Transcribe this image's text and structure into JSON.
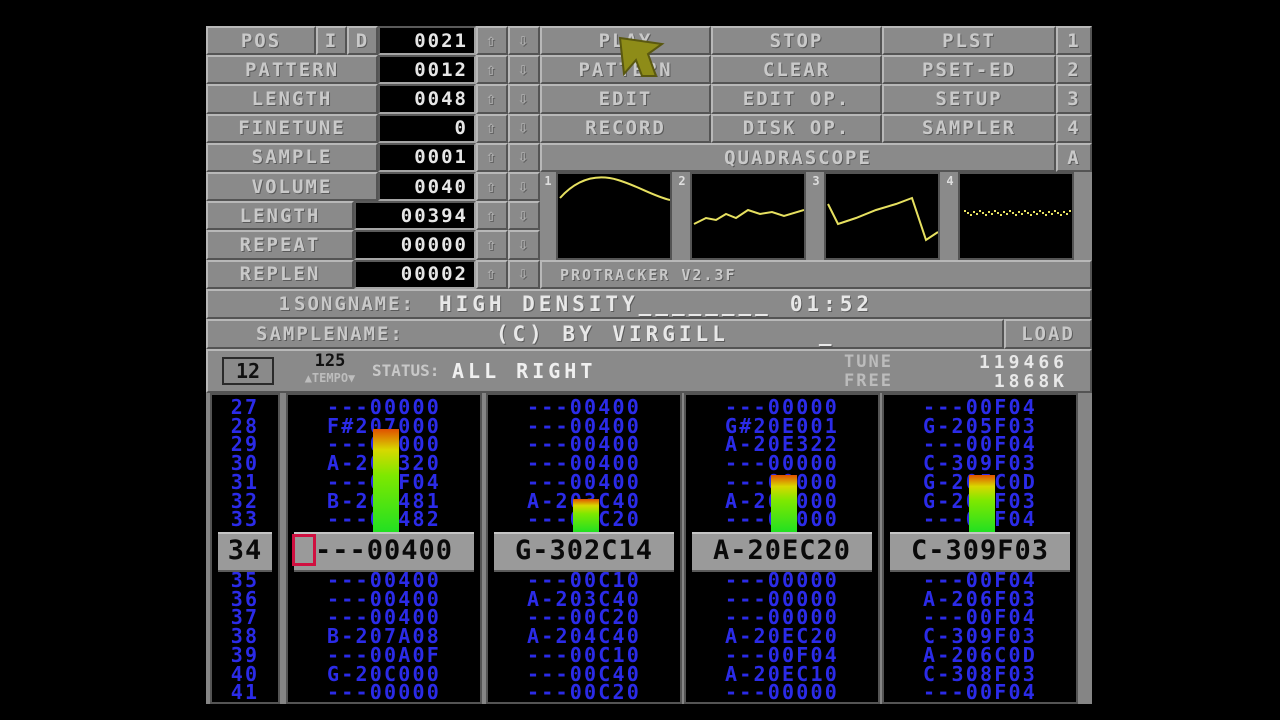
{
  "left_panel": {
    "rows": [
      {
        "label": "POS",
        "value": "0021",
        "extra": [
          "I",
          "D"
        ]
      },
      {
        "label": "PATTERN",
        "value": "0012"
      },
      {
        "label": "LENGTH",
        "value": "0048"
      },
      {
        "label": "FINETUNE",
        "value": "0"
      },
      {
        "label": "SAMPLE",
        "value": "0001"
      },
      {
        "label": "VOLUME",
        "value": "0040"
      },
      {
        "label": "LENGTH",
        "value": "00394"
      },
      {
        "label": "REPEAT",
        "value": "00000"
      },
      {
        "label": "REPLEN",
        "value": "00002"
      }
    ],
    "up_glyph": "⇧",
    "down_glyph": "⇩"
  },
  "menu": {
    "buttons": [
      [
        "PLAY",
        "STOP",
        "PLST",
        "1"
      ],
      [
        "PATTERN",
        "CLEAR",
        "PSET-ED",
        "2"
      ],
      [
        "EDIT",
        "EDIT OP.",
        "SETUP",
        "3"
      ],
      [
        "RECORD",
        "DISK OP.",
        "SAMPLER",
        "4"
      ]
    ],
    "quadrascope": "QUADRASCOPE",
    "quadrascope_key": "A"
  },
  "scopes": {
    "numbers": [
      "1",
      "2",
      "3",
      "4"
    ],
    "wave_color": "#e6e060"
  },
  "version_label": "PROTRACKER V2.3F",
  "song": {
    "prefix": "1",
    "label": "SONGNAME:",
    "name": "HIGH DENSITY________",
    "time": "01:52"
  },
  "sample": {
    "label": "SAMPLENAME:",
    "name": "(C)  BY VIRGILL",
    "underscore": "_",
    "load": "LOAD"
  },
  "status": {
    "octave": "12",
    "tempo_value": "125",
    "tempo_label": "▲TEMPO▼",
    "label": "STATUS:",
    "value": "ALL RIGHT",
    "tune_label": "TUNE",
    "tune_value": "119466",
    "free_label": "FREE",
    "free_value": "1868K"
  },
  "pattern": {
    "rows_before": [
      "27",
      "28",
      "29",
      "30",
      "31",
      "32",
      "33"
    ],
    "current_row": "34",
    "rows_after": [
      "35",
      "36",
      "37",
      "38",
      "39",
      "40",
      "41"
    ],
    "channels": [
      {
        "before": [
          "---00000",
          "F#207000",
          "---07000",
          "A-207320",
          "---00F04",
          "B-207481",
          "---00482"
        ],
        "current": "---00400",
        "after": [
          "---00400",
          "---00400",
          "---00400",
          "B-207A08",
          "---00A0F",
          "G-20C000",
          "---00000"
        ],
        "vu": 0.78
      },
      {
        "before": [
          "---00400",
          "---00400",
          "---00400",
          "---00400",
          "---00400",
          "A-203C40",
          "---00C20"
        ],
        "current": "G-302C14",
        "after": [
          "---00C10",
          "A-203C40",
          "---00C20",
          "A-204C40",
          "---00C10",
          "---00C40",
          "---00C20"
        ],
        "vu": 0.25
      },
      {
        "before": [
          "---00000",
          "G#20E001",
          "A-20E322",
          "---00000",
          "---00000",
          "A-20E000",
          "---00000"
        ],
        "current": "A-20EC20",
        "after": [
          "---00000",
          "---00000",
          "---00000",
          "A-20EC20",
          "---00F04",
          "A-20EC10",
          "---00000"
        ],
        "vu": 0.43
      },
      {
        "before": [
          "---00F04",
          "G-205F03",
          "---00F04",
          "C-309F03",
          "G-205C0D",
          "G-208F03",
          "---00F04"
        ],
        "current": "C-309F03",
        "after": [
          "---00F04",
          "A-206F03",
          "---00F04",
          "C-309F03",
          "A-206C0D",
          "C-308F03",
          "---00F04"
        ],
        "vu": 0.43
      }
    ]
  },
  "colors": {
    "pattern_text": "#2b2be8",
    "panel": "#8a8a8a",
    "cursor": "#d01040"
  }
}
